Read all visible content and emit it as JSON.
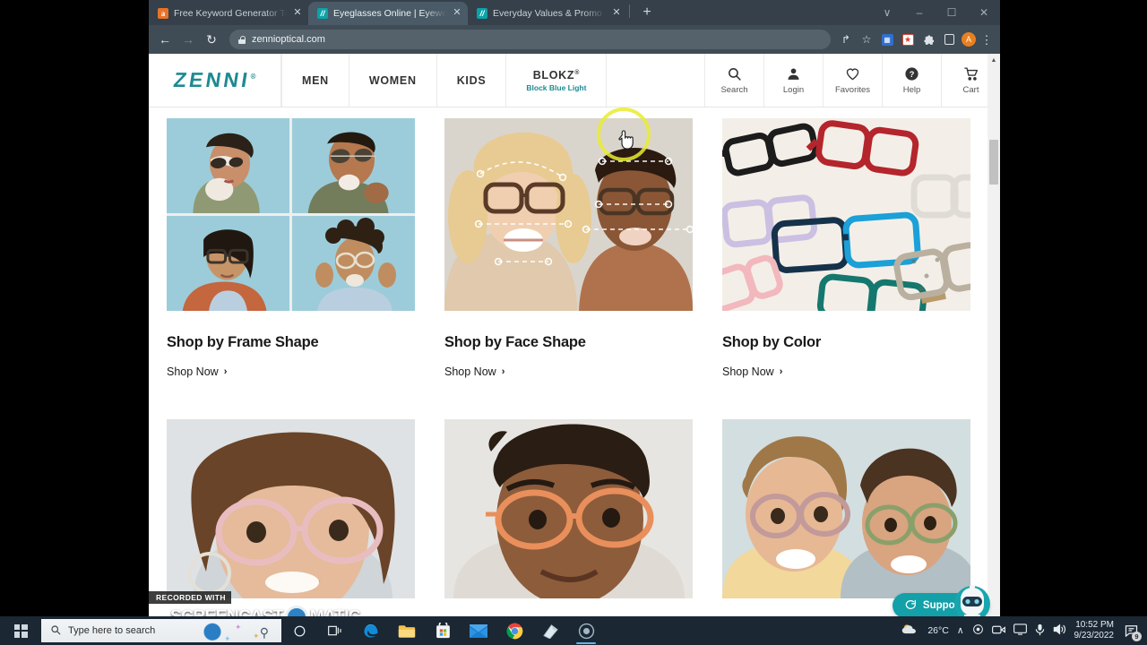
{
  "browser": {
    "tabs": [
      {
        "title": "Free Keyword Generator Tool: Fin",
        "favicon": "amazon-icon",
        "active": false
      },
      {
        "title": "Eyeglasses Online | Eyewear for E",
        "favicon": "zenni-icon",
        "active": true
      },
      {
        "title": "Everyday Values & Promo Codes",
        "favicon": "zenni-icon",
        "active": false
      }
    ],
    "new_tab_label": "+",
    "window_controls": {
      "minimize": "–",
      "maximize": "❐",
      "close": "✕",
      "chevron": "∨"
    },
    "nav": {
      "back": "←",
      "forward": "→",
      "reload": "↻"
    },
    "omnibox": {
      "url": "zennioptical.com",
      "lock_icon": "lock-icon"
    },
    "toolbar_icons": {
      "share": "↱",
      "bookmark": "☆",
      "ext_blue_glyph": "▤",
      "ext_red_glyph": "★",
      "ext_puzzle": "❖",
      "side_panel": "panel-icon",
      "profile_initial": "A",
      "menu": "⋮"
    }
  },
  "site": {
    "logo": "ZENNI",
    "logo_trademark": "®",
    "nav_items": [
      {
        "label": "MEN",
        "sub": ""
      },
      {
        "label": "WOMEN",
        "sub": ""
      },
      {
        "label": "KIDS",
        "sub": ""
      },
      {
        "label": "BLOKZ",
        "sup": "®",
        "sub": "Block Blue Light"
      }
    ],
    "util_items": [
      {
        "label": "Search",
        "icon": "search-icon"
      },
      {
        "label": "Login",
        "icon": "user-icon"
      },
      {
        "label": "Favorites",
        "icon": "heart-icon"
      },
      {
        "label": "Help",
        "icon": "question-circle-icon"
      },
      {
        "label": "Cart",
        "icon": "cart-icon"
      }
    ],
    "cards": [
      {
        "title": "Shop by Frame Shape",
        "cta": "Shop Now",
        "chevron": "›",
        "image": "four-people-wearing-glasses-grid"
      },
      {
        "title": "Shop by Face Shape",
        "cta": "Shop Now",
        "chevron": "›",
        "image": "two-faces-with-measurement-overlay"
      },
      {
        "title": "Shop by Color",
        "cta": "Shop Now",
        "chevron": "›",
        "image": "assorted-colored-eyeglass-frames"
      }
    ],
    "cards_row2": [
      {
        "image": "woman-with-pink-clear-glasses"
      },
      {
        "image": "man-with-orange-aviator-glasses"
      },
      {
        "image": "two-children-wearing-glasses"
      }
    ],
    "support": {
      "label": "Support",
      "icon": "chat-bubble-icon",
      "avatar": "robot-avatar"
    },
    "colors": {
      "brand_teal": "#1d8a92",
      "support_teal": "#13a0a8",
      "highlight_yellow": "#e8ec30"
    }
  },
  "watermark": {
    "line1": "RECORDED WITH",
    "line2a": "SCREENCAST",
    "line2b": "MATIC"
  },
  "taskbar": {
    "search_placeholder": "Type here to search",
    "apps": [
      {
        "name": "cortana-icon"
      },
      {
        "name": "task-view-icon"
      },
      {
        "name": "edge-icon"
      },
      {
        "name": "file-explorer-icon"
      },
      {
        "name": "microsoft-store-icon"
      },
      {
        "name": "mail-icon"
      },
      {
        "name": "chrome-icon"
      },
      {
        "name": "screencast-o-matic-icon"
      },
      {
        "name": "recorder-active-icon"
      }
    ],
    "tray": {
      "weather_icon": "partly-cloudy-icon",
      "temperature": "26°C",
      "chevron": "∧",
      "time": "10:52 PM",
      "date": "9/23/2022",
      "notification_count": "9"
    }
  }
}
